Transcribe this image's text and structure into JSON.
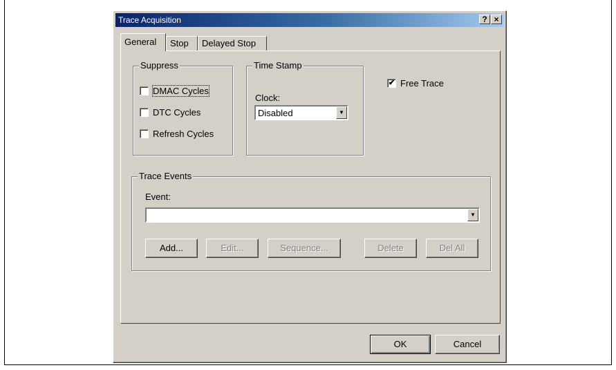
{
  "window": {
    "title": "Trace Acquisition",
    "help_button": "?",
    "close_button": "×"
  },
  "tabs": [
    {
      "label": "General",
      "active": true
    },
    {
      "label": "Stop",
      "active": false
    },
    {
      "label": "Delayed Stop",
      "active": false
    }
  ],
  "suppress": {
    "label": "Suppress",
    "items": [
      {
        "label": "DMAC Cycles",
        "checked": false,
        "focused": true
      },
      {
        "label": "DTC Cycles",
        "checked": false
      },
      {
        "label": "Refresh Cycles",
        "checked": false
      }
    ]
  },
  "time_stamp": {
    "label": "Time Stamp",
    "clock_label": "Clock:",
    "clock_value": "Disabled"
  },
  "free_trace": {
    "label": "Free Trace",
    "checked": true,
    "mark": "✔"
  },
  "trace_events": {
    "label": "Trace Events",
    "event_label": "Event:",
    "event_value": "",
    "buttons": {
      "add": "Add...",
      "edit": "Edit...",
      "sequence": "Sequence...",
      "delete": "Delete",
      "del_all": "Del All"
    }
  },
  "footer": {
    "ok": "OK",
    "cancel": "Cancel"
  },
  "colors": {
    "dialog_face": "#d4d0c8",
    "title_gradient_start": "#0a246a",
    "title_gradient_end": "#a6caf0"
  }
}
